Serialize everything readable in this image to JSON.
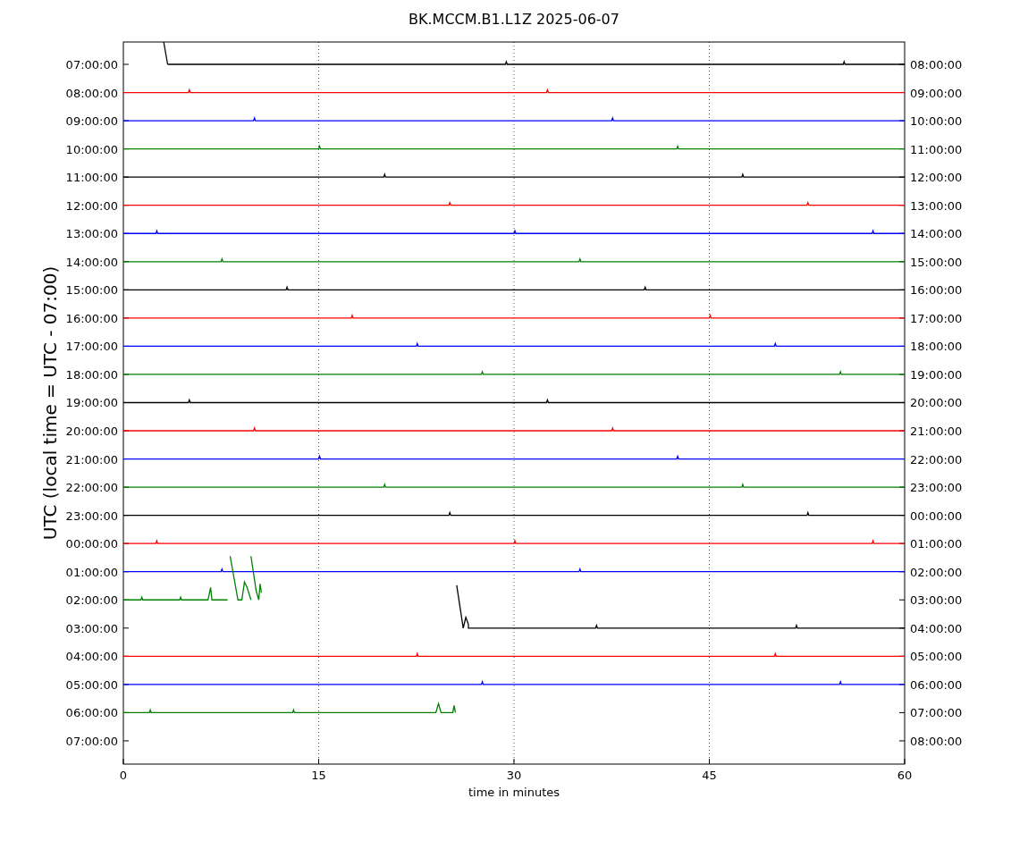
{
  "title": "BK.MCCM.B1.L1Z 2025-06-07",
  "ylabel": "UTC (local time = UTC - 07:00)",
  "xlabel": "time in minutes",
  "xticks": [
    "0",
    "15",
    "30",
    "45",
    "60"
  ],
  "rows": [
    {
      "left": "07:00:00",
      "right": "08:00:00",
      "color": "#000000"
    },
    {
      "left": "08:00:00",
      "right": "09:00:00",
      "color": "#ff0000"
    },
    {
      "left": "09:00:00",
      "right": "10:00:00",
      "color": "#0000ff"
    },
    {
      "left": "10:00:00",
      "right": "11:00:00",
      "color": "#008000"
    },
    {
      "left": "11:00:00",
      "right": "12:00:00",
      "color": "#000000"
    },
    {
      "left": "12:00:00",
      "right": "13:00:00",
      "color": "#ff0000"
    },
    {
      "left": "13:00:00",
      "right": "14:00:00",
      "color": "#0000ff"
    },
    {
      "left": "14:00:00",
      "right": "15:00:00",
      "color": "#008000"
    },
    {
      "left": "15:00:00",
      "right": "16:00:00",
      "color": "#000000"
    },
    {
      "left": "16:00:00",
      "right": "17:00:00",
      "color": "#ff0000"
    },
    {
      "left": "17:00:00",
      "right": "18:00:00",
      "color": "#0000ff"
    },
    {
      "left": "18:00:00",
      "right": "19:00:00",
      "color": "#008000"
    },
    {
      "left": "19:00:00",
      "right": "20:00:00",
      "color": "#000000"
    },
    {
      "left": "20:00:00",
      "right": "21:00:00",
      "color": "#ff0000"
    },
    {
      "left": "21:00:00",
      "right": "22:00:00",
      "color": "#0000ff"
    },
    {
      "left": "22:00:00",
      "right": "23:00:00",
      "color": "#008000"
    },
    {
      "left": "23:00:00",
      "right": "00:00:00",
      "color": "#000000"
    },
    {
      "left": "00:00:00",
      "right": "01:00:00",
      "color": "#ff0000"
    },
    {
      "left": "01:00:00",
      "right": "02:00:00",
      "color": "#0000ff"
    },
    {
      "left": "02:00:00",
      "right": "03:00:00",
      "color": "#008000"
    },
    {
      "left": "03:00:00",
      "right": "04:00:00",
      "color": "#000000"
    },
    {
      "left": "04:00:00",
      "right": "05:00:00",
      "color": "#ff0000"
    },
    {
      "left": "05:00:00",
      "right": "06:00:00",
      "color": "#0000ff"
    },
    {
      "left": "06:00:00",
      "right": "07:00:00",
      "color": "#008000"
    },
    {
      "left": "07:00:00",
      "right": "08:00:00"
    }
  ]
}
